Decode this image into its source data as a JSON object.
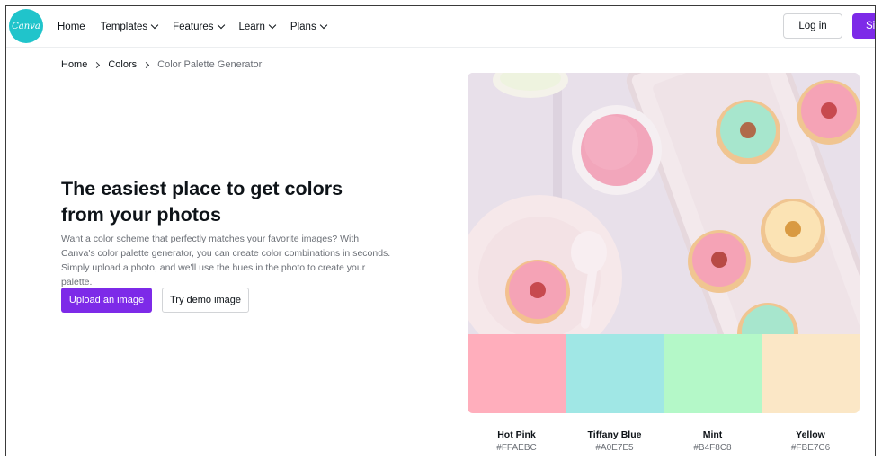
{
  "header": {
    "logo_text": "Canva",
    "nav": [
      {
        "label": "Home",
        "has_menu": false
      },
      {
        "label": "Templates",
        "has_menu": true
      },
      {
        "label": "Features",
        "has_menu": true
      },
      {
        "label": "Learn",
        "has_menu": true
      },
      {
        "label": "Plans",
        "has_menu": true
      }
    ],
    "login_label": "Log in",
    "signup_label": "Si"
  },
  "breadcrumb": {
    "items": [
      "Home",
      "Colors",
      "Color Palette Generator"
    ]
  },
  "hero": {
    "title": "The easiest place to get colors from your photos",
    "description": "Want a color scheme that perfectly matches your favorite images? With Canva's color palette generator, you can create color combinations in seconds. Simply upload a photo, and we'll use the hues in the photo to create your palette.",
    "upload_label": "Upload an image",
    "demo_label": "Try demo image"
  },
  "palette": {
    "colors": [
      {
        "name": "Hot Pink",
        "hex": "#FFAEBC"
      },
      {
        "name": "Tiffany Blue",
        "hex": "#A0E7E5"
      },
      {
        "name": "Mint",
        "hex": "#B4F8C8"
      },
      {
        "name": "Yellow",
        "hex": "#FBE7C6"
      }
    ]
  },
  "colors": {
    "brand_purple": "#7d2ae8",
    "logo_teal": "#20c4cb"
  }
}
